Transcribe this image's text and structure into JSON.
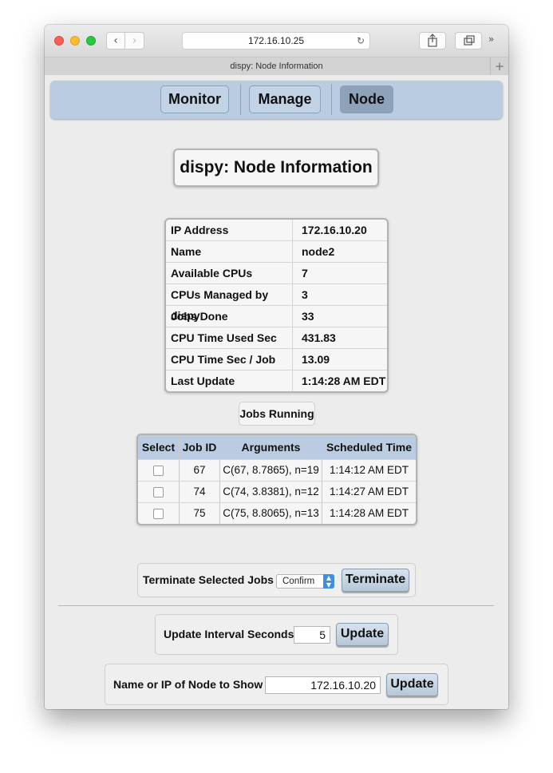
{
  "browser": {
    "url": "172.16.10.25",
    "tab_title": "dispy: Node Information",
    "back_glyph": "‹",
    "forward_glyph": "›",
    "reload_glyph": "↻",
    "more_glyph": "»",
    "newtab_glyph": "+"
  },
  "menu": {
    "items": [
      {
        "label": "Monitor"
      },
      {
        "label": "Manage"
      },
      {
        "label": "Node",
        "active": true
      }
    ]
  },
  "page": {
    "title": "dispy: Node Information"
  },
  "node_info": {
    "rows": [
      {
        "label": "IP Address",
        "value": "172.16.10.20"
      },
      {
        "label": "Name",
        "value": "node2"
      },
      {
        "label": "Available CPUs",
        "value": "7"
      },
      {
        "label": "CPUs Managed by dispy",
        "value": "3"
      },
      {
        "label": "Jobs Done",
        "value": "33"
      },
      {
        "label": "CPU Time Used Sec",
        "value": "431.83"
      },
      {
        "label": "CPU Time Sec / Job",
        "value": "13.09"
      },
      {
        "label": "Last Update",
        "value": "1:14:28 AM EDT"
      }
    ]
  },
  "jobs": {
    "title": "Jobs Running",
    "headers": [
      "Select",
      "Job ID",
      "Arguments",
      "Scheduled Time"
    ],
    "rows": [
      {
        "job_id": "67",
        "arguments": "C(67, 8.7865), n=19",
        "scheduled": "1:14:12 AM EDT"
      },
      {
        "job_id": "74",
        "arguments": "C(74, 3.8381), n=12",
        "scheduled": "1:14:27 AM EDT"
      },
      {
        "job_id": "75",
        "arguments": "C(75, 8.8065), n=13",
        "scheduled": "1:14:28 AM EDT"
      }
    ]
  },
  "terminate": {
    "label": "Terminate Selected Jobs :",
    "select_value": "Confirm",
    "button": "Terminate"
  },
  "interval": {
    "label": "Update Interval Seconds:",
    "value": "5",
    "button": "Update"
  },
  "node_select": {
    "label": "Name or IP of Node to Show :",
    "value": "172.16.10.20",
    "button": "Update"
  },
  "colors": {
    "menu_bg": "#b9cce1",
    "menu_active": "#8ea3b9",
    "header_bg": "#b9cce1"
  }
}
